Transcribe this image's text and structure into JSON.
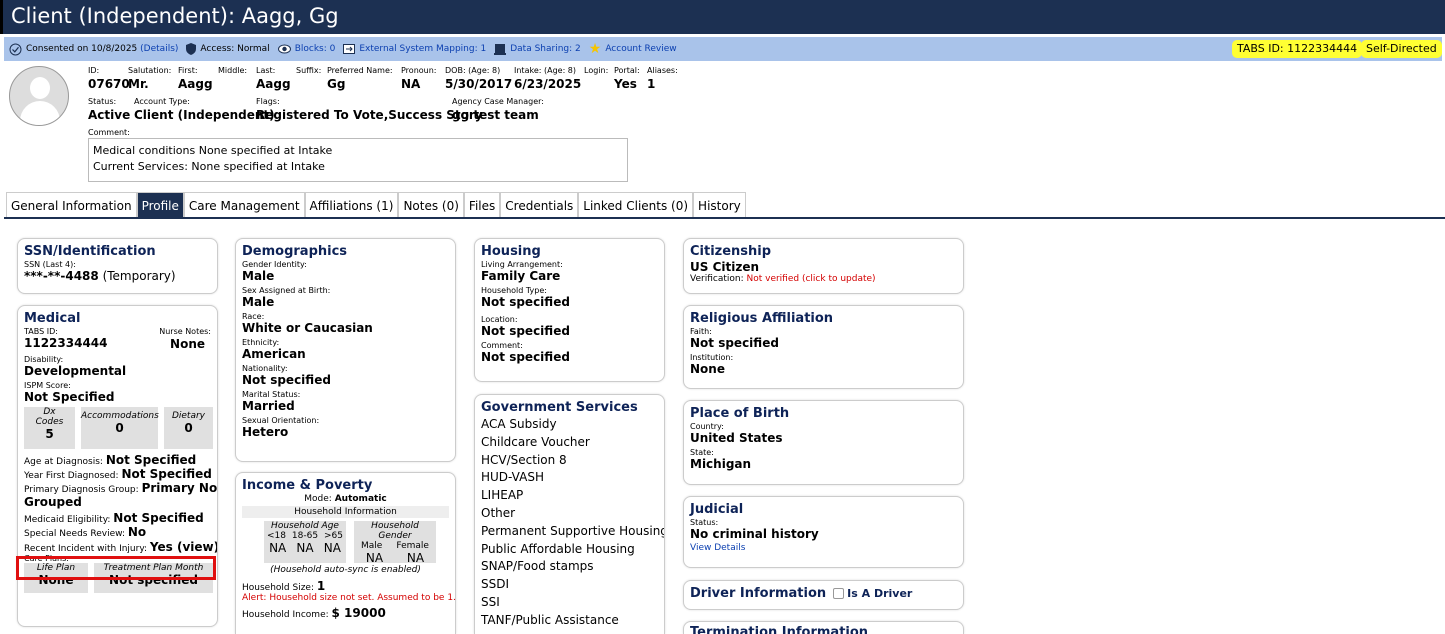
{
  "title": "Client (Independent): Aagg, Gg",
  "infobar": {
    "consented": "Consented on 10/8/2025",
    "details": "(Details)",
    "access": "Access: Normal",
    "blocks": "Blocks: 0",
    "external": "External System Mapping: 1",
    "sharing": "Data Sharing: 2",
    "review": "Account Review",
    "tabs_id": "TABS ID: 1122334444",
    "self_directed": "Self-Directed"
  },
  "header": {
    "id_label": "ID:",
    "id": "07670",
    "salutation_label": "Salutation:",
    "salutation": "Mr.",
    "first_label": "First:",
    "first": "Aagg",
    "middle_label": "Middle:",
    "last_label": "Last:",
    "last": "Aagg",
    "suffix_label": "Suffix:",
    "preferred_label": "Preferred Name:",
    "preferred": "Gg",
    "pronoun_label": "Pronoun:",
    "pronoun": "NA",
    "dob_label": "DOB: (Age: 8)",
    "dob": "5/30/2017",
    "intake_label": "Intake: (Age: 8)",
    "intake": "6/23/2025",
    "login_label": "Login:",
    "portal_label": "Portal:",
    "portal": "Yes",
    "aliases_label": "Aliases:",
    "aliases": "1",
    "status_label": "Status:",
    "status": "Active",
    "account_type_label": "Account Type:",
    "account_type": "Client (Independent)",
    "flags_label": "Flags:",
    "flags": "Registered To Vote,Success Story",
    "manager_label": "Agency Case Manager:",
    "manager": "gg test team",
    "comment_label": "Comment:",
    "comment_line1": "Medical conditions None specified at Intake",
    "comment_line2": "Current Services: None specified at Intake"
  },
  "tabs": [
    "General Information",
    "Profile",
    "Care Management",
    "Affiliations (1)",
    "Notes (0)",
    "Files",
    "Credentials",
    "Linked Clients (0)",
    "History"
  ],
  "ssn": {
    "title": "SSN/Identification",
    "label": "SSN (Last 4):",
    "value": "***-**-4488",
    "note": "(Temporary)"
  },
  "medical": {
    "title": "Medical",
    "tabs_label": "TABS ID:",
    "tabs_value": "1122334444",
    "nurse_label": "Nurse Notes:",
    "nurse_value": "None",
    "disability_label": "Disability:",
    "disability": "Developmental",
    "ispm_label": "ISPM Score:",
    "ispm": "Not Specified",
    "dx_label_1": "Dx",
    "dx_label_2": "Codes",
    "dx": "5",
    "acc_label": "Accommodations",
    "acc": "0",
    "dietary_label": "Dietary",
    "dietary": "0",
    "age_dx_label": "Age at Diagnosis:",
    "age_dx": "Not Specified",
    "year_dx_label": "Year First Diagnosed:",
    "year_dx": "Not Specified",
    "pdg_label": "Primary Diagnosis Group:",
    "pdg_1": "Primary Not",
    "pdg_2": "Grouped",
    "medicaid_label": "Medicaid Eligibility:",
    "medicaid": "Not Specified",
    "special_label": "Special Needs Review:",
    "special": "No",
    "incident_label": "Recent Incident with Injury:",
    "incident": "Yes (view)",
    "care_label": "Care Plans:",
    "life_label": "Life Plan",
    "life": "None",
    "tpm_label": "Treatment Plan Month",
    "tpm": "Not specified"
  },
  "demographics": {
    "title": "Demographics",
    "gender_label": "Gender Identity:",
    "gender": "Male",
    "sex_label": "Sex Assigned at Birth:",
    "sex": "Male",
    "race_label": "Race:",
    "race": "White or Caucasian",
    "eth_label": "Ethnicity:",
    "eth": "American",
    "nat_label": "Nationality:",
    "nat": "Not specified",
    "marital_label": "Marital Status:",
    "marital": "Married",
    "orient_label": "Sexual Orientation:",
    "orient": "Hetero"
  },
  "income": {
    "title": "Income & Poverty",
    "mode_label": "Mode:",
    "mode": "Automatic",
    "hh_info": "Household Information",
    "age_label": "Household Age",
    "age_cols": [
      "<18",
      "18-65",
      ">65"
    ],
    "age_vals": [
      "NA",
      "NA",
      "NA"
    ],
    "gender_label": "Household Gender",
    "gender_cols": [
      "Male",
      "Female"
    ],
    "gender_vals": [
      "NA",
      "NA"
    ],
    "autosync": "(Household auto-sync is enabled)",
    "size_label": "Household Size:",
    "size": "1",
    "alert": "Alert: Household size not set. Assumed to be 1.",
    "income_label": "Household Income:",
    "income": "$ 19000"
  },
  "housing": {
    "title": "Housing",
    "arr_label": "Living Arrangement:",
    "arr": "Family Care",
    "type_label": "Household Type:",
    "type": "Not specified",
    "loc_label": "Location:",
    "loc": "Not specified",
    "comment_label": "Comment:",
    "comment": "Not specified"
  },
  "government": {
    "title": "Government Services",
    "items": [
      "ACA Subsidy",
      "Childcare Voucher",
      "HCV/Section 8",
      "HUD-VASH",
      "LIHEAP",
      "Other",
      "Permanent Supportive Housing",
      "Public Affordable Housing",
      "SNAP/Food stamps",
      "SSDI",
      "SSI",
      "TANF/Public Assistance"
    ]
  },
  "citizenship": {
    "title": "Citizenship",
    "value": "US Citizen",
    "ver_label": "Verification:",
    "ver": "Not verified (click to update)"
  },
  "religious": {
    "title": "Religious Affiliation",
    "faith_label": "Faith:",
    "faith": "Not specified",
    "inst_label": "Institution:",
    "inst": "None"
  },
  "birth": {
    "title": "Place of Birth",
    "country_label": "Country:",
    "country": "United States",
    "state_label": "State:",
    "state": "Michigan"
  },
  "judicial": {
    "title": "Judicial",
    "status_label": "Status:",
    "status": "No criminal history",
    "details": "View Details"
  },
  "driver": {
    "title": "Driver Information",
    "check_label": "Is A Driver"
  },
  "termination": {
    "title": "Termination Information"
  }
}
